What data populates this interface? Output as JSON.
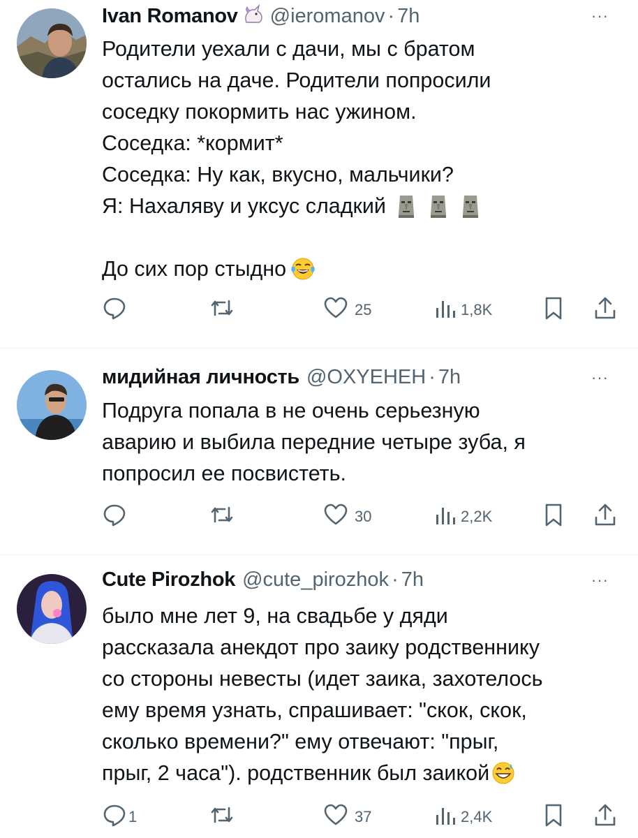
{
  "tweets": [
    {
      "name": "Ivan Romanov",
      "handle": "@ieromanov",
      "sep": "·",
      "time": "7h",
      "more": "···",
      "lines": [
        "Родители уехали с дачи, мы с братом",
        "остались на даче. Родители попросили",
        "соседку покормить нас ужином.",
        "Соседка: *кормит*",
        "Соседка: Ну как, вкусно, мальчики?",
        "Я: Нахаляву и уксус сладкий"
      ],
      "last_line": "До сих пор стыдно",
      "replies": "",
      "retweets": "",
      "likes": "25",
      "views": "1,8K"
    },
    {
      "name": "мидийная личность",
      "handle": "@OXYEHEH",
      "sep": "·",
      "time": "7h",
      "more": "···",
      "lines": [
        "Подруга попала в не очень серьезную",
        "аварию и выбила передние четыре зуба, я",
        "попросил ее посвистеть."
      ],
      "replies": "",
      "retweets": "",
      "likes": "30",
      "views": "2,2K"
    },
    {
      "name": "Cute Pirozhok",
      "handle": "@cute_pirozhok",
      "sep": "·",
      "time": "7h",
      "more": "···",
      "lines": [
        "было мне лет 9, на свадьбе у дяди",
        "рассказала анекдот про заику родственнику",
        "со стороны невесты (идет заика, захотелось",
        "ему время узнать, спрашивает: \"скок, скок,",
        "сколько времени?\" ему отвечают: \"прыг,",
        "прыг, 2 часа\"). родственник был заикой"
      ],
      "replies": "1",
      "retweets": "",
      "likes": "37",
      "views": "2,4K"
    }
  ],
  "icons": {
    "reply": "reply-icon",
    "retweet": "retweet-icon",
    "like": "heart-icon",
    "views": "views-icon",
    "bookmark": "bookmark-icon",
    "share": "share-icon",
    "badge": "unicorn-icon",
    "emoji_moai": "moai-emoji-icon",
    "emoji_laugh": "tears-of-joy-emoji-icon",
    "emoji_sweat": "grinning-sweat-emoji-icon"
  },
  "colors": {
    "text": "#0f1419",
    "muted": "#536471",
    "divider": "#eff3f4"
  }
}
